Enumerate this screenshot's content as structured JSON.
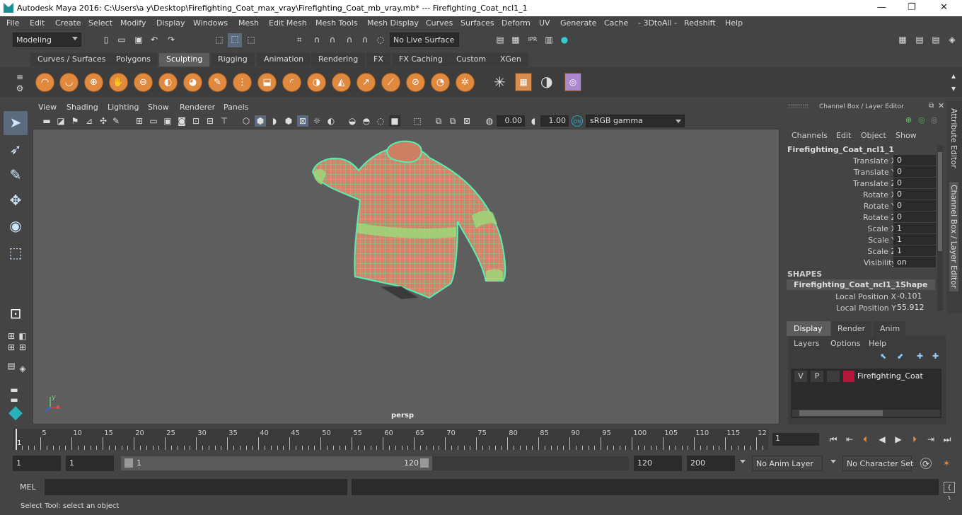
{
  "window": {
    "title": "Autodesk Maya 2016: C:\\Users\\a y\\Desktop\\Firefighting_Coat_max_vray\\Firefighting_Coat_mb_vray.mb*   ---   Firefighting_Coat_ncl1_1",
    "min": "—",
    "max": "❐",
    "close": "✕"
  },
  "menubar": [
    "File",
    "Edit",
    "Create",
    "Select",
    "Modify",
    "Display",
    "Windows",
    "Mesh",
    "Edit Mesh",
    "Mesh Tools",
    "Mesh Display",
    "Curves",
    "Surfaces",
    "Deform",
    "UV",
    "Generate",
    "Cache",
    "- 3DtoAll -",
    "Redshift",
    "Help"
  ],
  "statusline": {
    "mode": "Modeling",
    "live_surface": "No Live Surface"
  },
  "shelf_tabs": [
    "Curves / Surfaces",
    "Polygons",
    "Sculpting",
    "Rigging",
    "Animation",
    "Rendering",
    "FX",
    "FX Caching",
    "Custom",
    "XGen"
  ],
  "shelf_active": "Sculpting",
  "viewport_menu": [
    "View",
    "Shading",
    "Lighting",
    "Show",
    "Renderer",
    "Panels"
  ],
  "viewport_toolbar": {
    "value1": "0.00",
    "value2": "1.00",
    "colorspace": "sRGB gamma"
  },
  "viewport": {
    "camera": "persp",
    "axis_x": "x",
    "axis_y": "y"
  },
  "channel_box": {
    "title": "Channel Box / Layer Editor",
    "menu": [
      "Channels",
      "Edit",
      "Object",
      "Show"
    ],
    "object": "Firefighting_Coat_ncl1_1",
    "channels": [
      {
        "label": "Translate X",
        "value": "0"
      },
      {
        "label": "Translate Y",
        "value": "0"
      },
      {
        "label": "Translate Z",
        "value": "0"
      },
      {
        "label": "Rotate X",
        "value": "0"
      },
      {
        "label": "Rotate Y",
        "value": "0"
      },
      {
        "label": "Rotate Z",
        "value": "0"
      },
      {
        "label": "Scale X",
        "value": "1"
      },
      {
        "label": "Scale Y",
        "value": "1"
      },
      {
        "label": "Scale Z",
        "value": "1"
      },
      {
        "label": "Visibility",
        "value": "on"
      }
    ],
    "shapes_heading": "SHAPES",
    "shape_name": "Firefighting_Coat_ncl1_1Shape",
    "shape_channels": [
      {
        "label": "Local Position X",
        "value": "-0.101"
      },
      {
        "label": "Local Position Y",
        "value": "55.912"
      }
    ]
  },
  "side_tabs": [
    "Attribute Editor",
    "Channel Box / Layer Editor"
  ],
  "layer_editor": {
    "tabs": [
      "Display",
      "Render",
      "Anim"
    ],
    "menu": [
      "Layers",
      "Options",
      "Help"
    ],
    "layer": {
      "v": "V",
      "p": "P",
      "name": "Firefighting_Coat",
      "color": "#b5173a"
    }
  },
  "timeline": {
    "ticks": [
      "5",
      "10",
      "15",
      "20",
      "25",
      "30",
      "35",
      "40",
      "45",
      "50",
      "55",
      "60",
      "65",
      "70",
      "75",
      "80",
      "85",
      "90",
      "95",
      "100",
      "105",
      "110",
      "115",
      "12"
    ],
    "start_marker": "1",
    "current_frame": "1"
  },
  "range": {
    "start": "1",
    "playback_start": "1",
    "slider_start": "1",
    "slider_end": "120",
    "playback_end": "120",
    "end": "200",
    "anim_layer": "No Anim Layer",
    "character_set": "No Character Set"
  },
  "command": {
    "label": "MEL"
  },
  "help_line": "Select Tool: select an object",
  "colors": {
    "wireframe": "#55f0b0",
    "coat": "#d88a6a",
    "accent_orange": "#e08a40"
  }
}
